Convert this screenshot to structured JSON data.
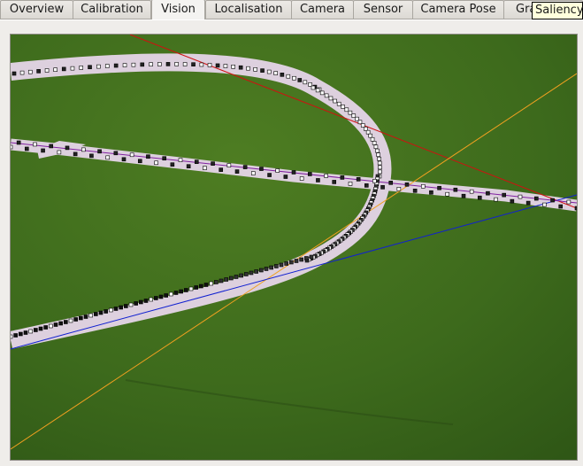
{
  "tabs": [
    {
      "id": "overview",
      "label": "Overview",
      "active": false
    },
    {
      "id": "calibration",
      "label": "Calibration",
      "active": false
    },
    {
      "id": "vision",
      "label": "Vision",
      "active": true
    },
    {
      "id": "localisation",
      "label": "Localisation",
      "active": false
    },
    {
      "id": "camera",
      "label": "Camera",
      "active": false
    },
    {
      "id": "sensor",
      "label": "Sensor",
      "active": false
    },
    {
      "id": "camera-pose",
      "label": "Camera Pose",
      "active": false
    },
    {
      "id": "graph",
      "label": "Gra",
      "active": false
    }
  ],
  "tooltip": {
    "text": "Saliency"
  },
  "vision_view": {
    "field_color": "#3f6a1c",
    "line_color": "#ddd0de",
    "overlay_colors": {
      "red": "#d01010",
      "orange": "#f0a020",
      "blue": "#1020d0",
      "purple": "#8020a0"
    }
  }
}
